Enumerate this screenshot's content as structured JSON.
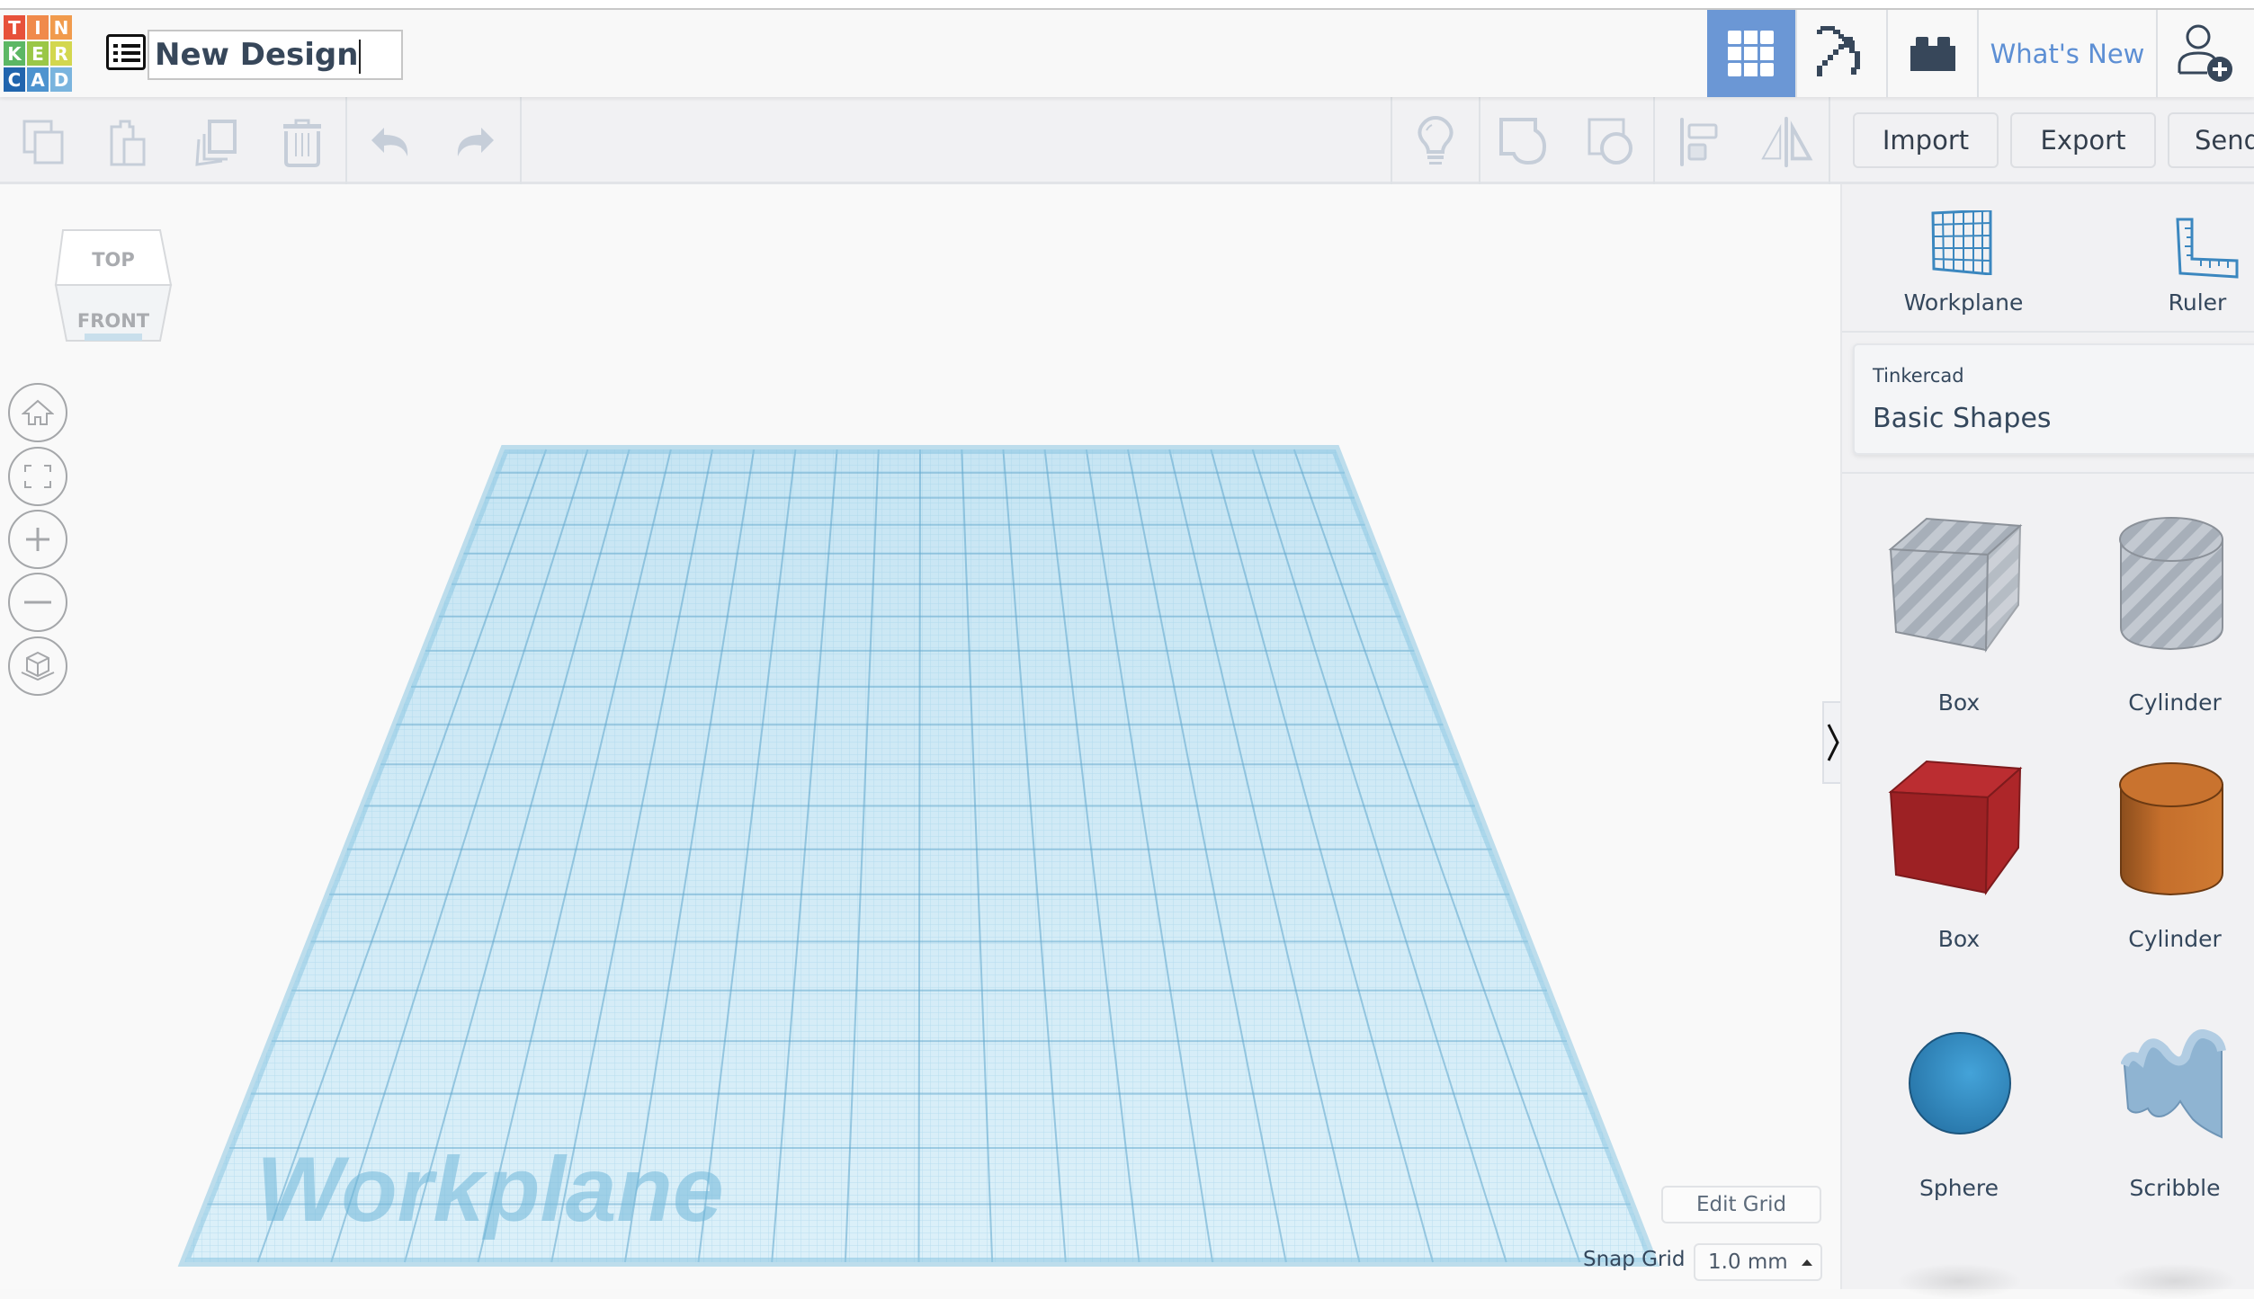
{
  "app": {
    "logo_letters": [
      "T",
      "I",
      "N",
      "K",
      "E",
      "R",
      "C",
      "A",
      "D"
    ],
    "logo_colors": [
      "#e7513a",
      "#f08a4b",
      "#f19b4d",
      "#5cb764",
      "#9ac747",
      "#d3d74e",
      "#2165ae",
      "#4d93cf",
      "#7ab4de"
    ],
    "design_title": "New Design"
  },
  "topbar": {
    "view_3d_icon": "grid-icon",
    "minecraft_icon": "pickaxe-icon",
    "bricks_icon": "brick-icon",
    "whats_new": "What's New",
    "user_icon": "add-user-icon",
    "accent": "#6b97d5"
  },
  "toolbar": {
    "copy_icon": "copy-icon",
    "paste_icon": "paste-icon",
    "duplicate_icon": "duplicate-icon",
    "delete_icon": "trash-icon",
    "undo_icon": "undo-icon",
    "redo_icon": "redo-icon",
    "notes_icon": "lightbulb-icon",
    "group_icon": "group-icon",
    "ungroup_icon": "ungroup-icon",
    "align_icon": "align-icon",
    "mirror_icon": "mirror-icon",
    "import": "Import",
    "export": "Export",
    "send": "Send"
  },
  "viewcube": {
    "top": "TOP",
    "front": "FRONT"
  },
  "nav": [
    "home-icon",
    "fit-view-icon",
    "zoom-in-icon",
    "zoom-out-icon",
    "ortho-view-icon"
  ],
  "workplane": {
    "label": "Workplane",
    "edit_grid": "Edit Grid",
    "snap_grid_label": "Snap Grid",
    "snap_grid_value": "1.0 mm"
  },
  "panel": {
    "tools": [
      {
        "label": "Workplane",
        "icon": "workplane-icon"
      },
      {
        "label": "Ruler",
        "icon": "ruler-icon"
      }
    ],
    "category_source": "Tinkercad",
    "category_name": "Basic Shapes",
    "shapes": [
      {
        "label": "Box",
        "icon": "hole-box-icon"
      },
      {
        "label": "Cylinder",
        "icon": "hole-cylinder-icon"
      },
      {
        "label": "Box",
        "icon": "box-icon"
      },
      {
        "label": "Cylinder",
        "icon": "cylinder-icon"
      },
      {
        "label": "Sphere",
        "icon": "sphere-icon"
      },
      {
        "label": "Scribble",
        "icon": "scribble-icon"
      }
    ]
  }
}
